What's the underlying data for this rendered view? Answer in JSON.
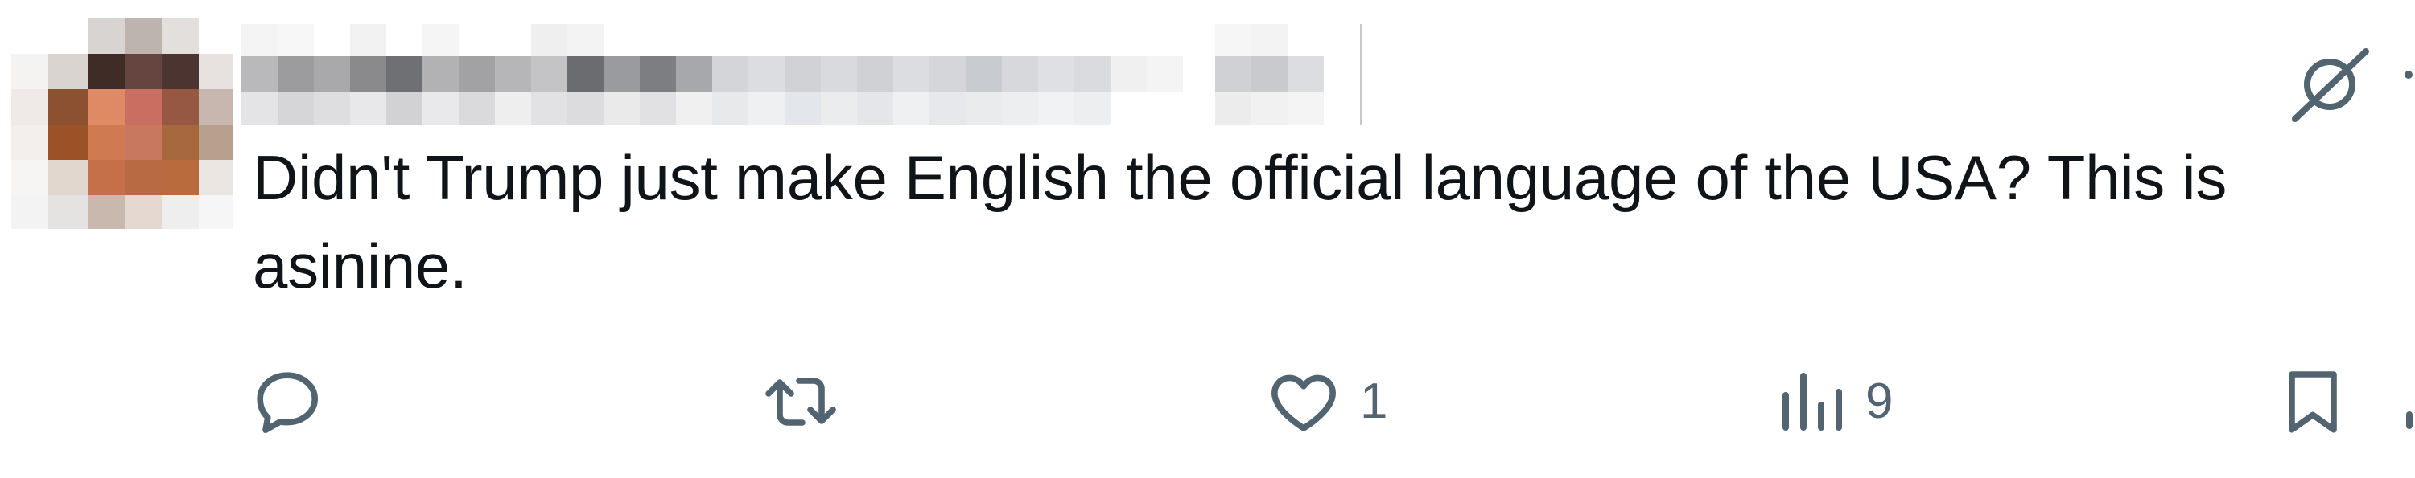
{
  "tweet": {
    "text": "Didn't Trump just make English the official language of the USA? This is asinine."
  },
  "actions": {
    "reply": {
      "icon": "reply-icon",
      "count": ""
    },
    "retweet": {
      "icon": "retweet-icon",
      "count": ""
    },
    "like": {
      "icon": "heart-icon",
      "count": "1"
    },
    "views": {
      "icon": "views-chart-icon",
      "count": "9"
    },
    "bookmark": {
      "icon": "bookmark-icon",
      "count": ""
    }
  },
  "colors": {
    "text": "#0f1419",
    "icon": "#536471",
    "background": "#ffffff"
  }
}
